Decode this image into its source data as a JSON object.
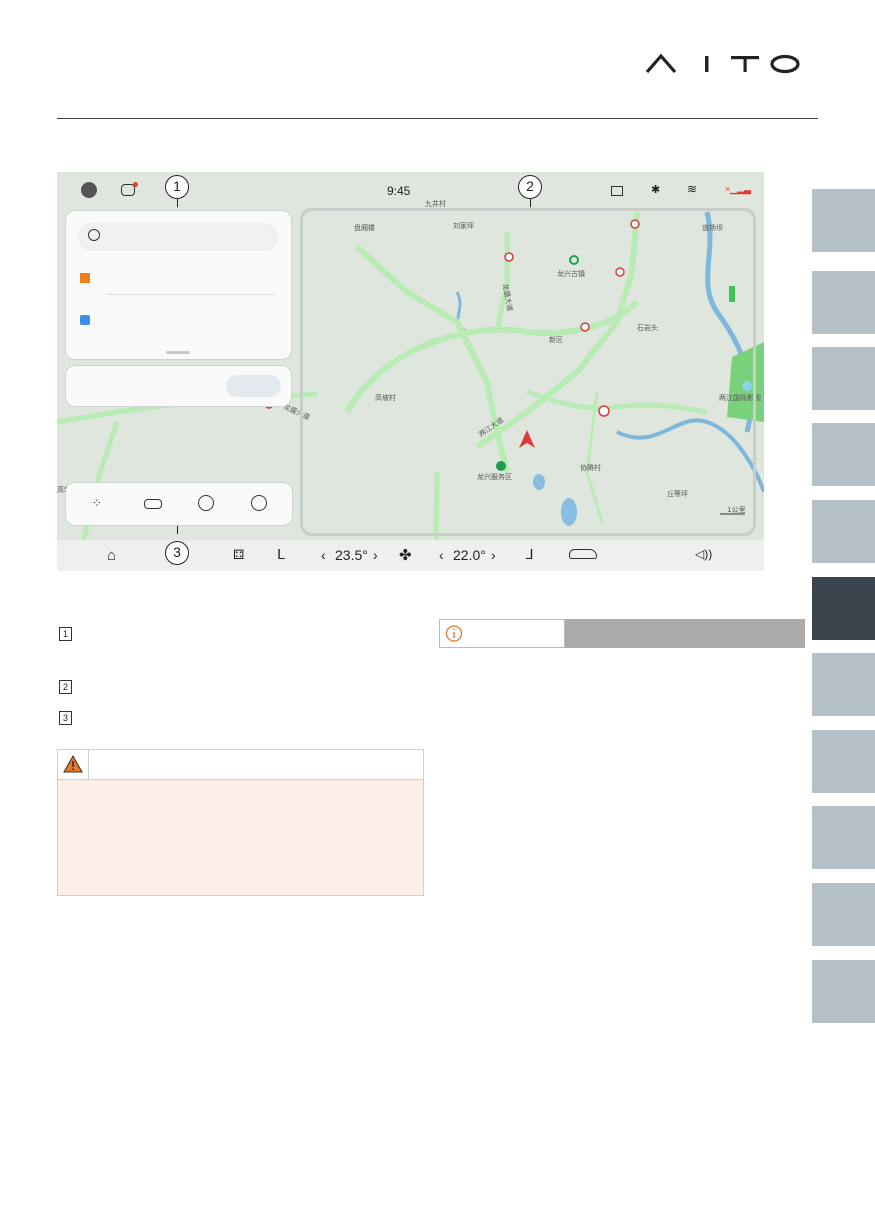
{
  "header": {
    "brand": "AITO"
  },
  "screen": {
    "status_bar": {
      "time": "9:45"
    },
    "map_labels": [
      "九井村",
      "盘厢楼",
      "刘家坪",
      "道场坝",
      "龙兴古镇",
      "龙盛大道",
      "新区",
      "石岩头",
      "高坡村",
      "两江大道",
      "两江国际影视",
      "龙兴服务区",
      "协腾村",
      "丘等坪",
      "1公里",
      "龙盛大道",
      "高新区"
    ],
    "climate": {
      "left_temp": "23.5°",
      "right_temp": "22.0°"
    },
    "callouts": [
      "1",
      "2",
      "3"
    ],
    "icons": {
      "status": [
        "avatar-icon",
        "message-icon",
        "wifi-icon",
        "bluetooth-icon",
        "camera-icon",
        "signal-icon"
      ],
      "bottom": [
        "home-icon",
        "defrost-icon",
        "seat-icon",
        "fan-icon",
        "seat-heat-icon",
        "car-icon",
        "volume-icon"
      ],
      "tools": [
        "grid-icon",
        "traffic-icon",
        "compass-icon",
        "locate-icon"
      ]
    }
  },
  "legend": [
    "1",
    "2",
    "3"
  ],
  "colors": {
    "tab": "#b4bfc6",
    "tab_active": "#3a454d",
    "warning_bg": "#fcefe7",
    "info_bar": "#ababab",
    "accent_red": "#e03a3a"
  }
}
